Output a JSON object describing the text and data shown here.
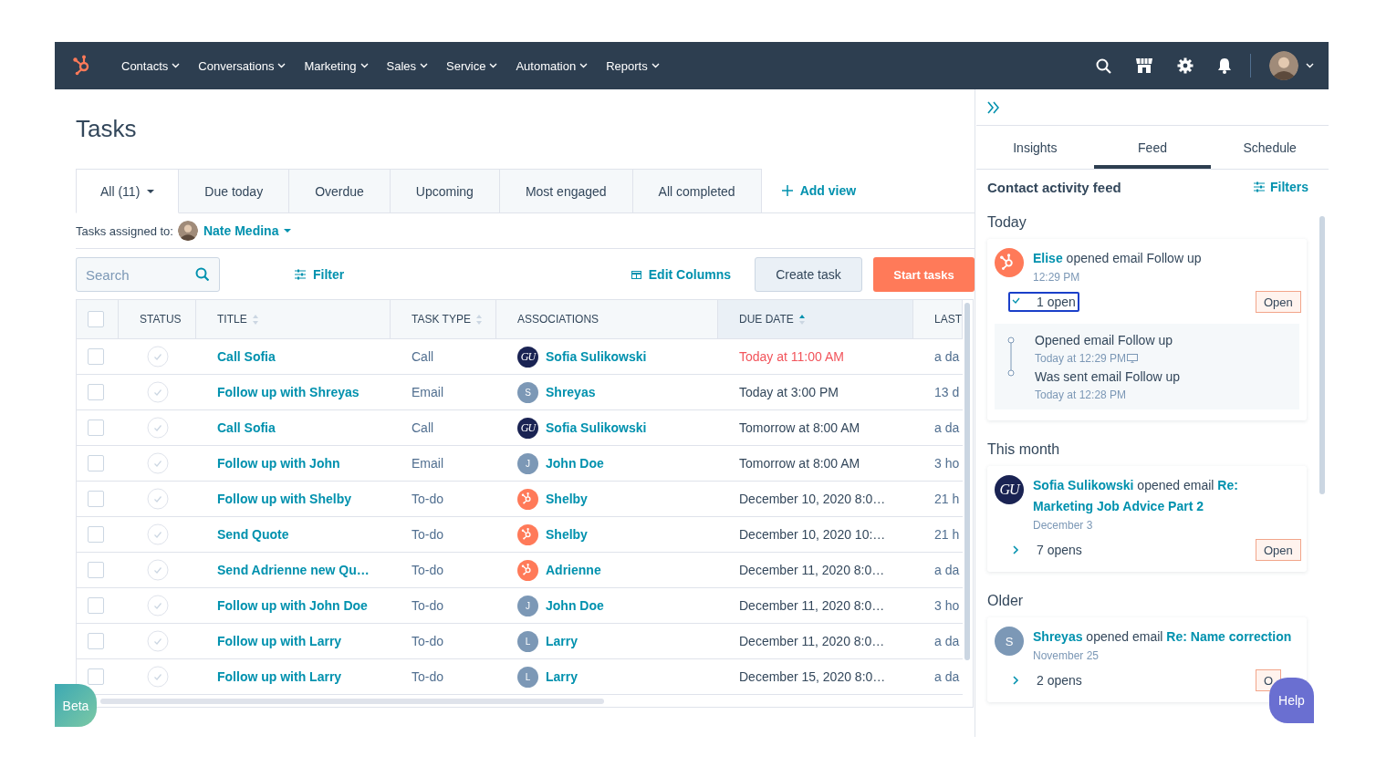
{
  "nav": {
    "items": [
      {
        "label": "Contacts"
      },
      {
        "label": "Conversations"
      },
      {
        "label": "Marketing"
      },
      {
        "label": "Sales"
      },
      {
        "label": "Service"
      },
      {
        "label": "Automation"
      },
      {
        "label": "Reports"
      }
    ]
  },
  "page": {
    "title": "Tasks",
    "views": [
      {
        "label": "All (11)",
        "selected": true,
        "menu": true
      },
      {
        "label": "Due today",
        "selected": false
      },
      {
        "label": "Overdue",
        "selected": false
      },
      {
        "label": "Upcoming",
        "selected": false
      },
      {
        "label": "Most engaged",
        "selected": false
      },
      {
        "label": "All completed",
        "selected": false
      }
    ],
    "add_view": "Add view",
    "assigned_label": "Tasks assigned to:",
    "assignee": "Nate Medina",
    "search": {
      "placeholder": "Search"
    },
    "filter": "Filter",
    "edit_columns": "Edit Columns",
    "create_task": "Create task",
    "start_tasks": "Start tasks",
    "table": {
      "header_checked": false,
      "columns": [
        {
          "label": "STATUS",
          "sortable": false
        },
        {
          "label": "TITLE",
          "sortable": true,
          "sorted": false
        },
        {
          "label": "TASK TYPE",
          "sortable": true,
          "sorted": false
        },
        {
          "label": "ASSOCIATIONS",
          "sortable": false
        },
        {
          "label": "DUE DATE",
          "sortable": true,
          "sorted": true
        },
        {
          "label": "LAST",
          "sortable": false
        }
      ],
      "rows": [
        {
          "checked": false,
          "completed": false,
          "title": "Call Sofia",
          "task_type": "Call",
          "association": {
            "name": "Sofia Sulikowski",
            "avatar": {
              "kind": "monogram",
              "text": "GU"
            }
          },
          "due_date": "Today at 11:00 AM",
          "overdue": true,
          "last": "a da"
        },
        {
          "checked": false,
          "completed": false,
          "title": "Follow up with Shreyas",
          "task_type": "Email",
          "association": {
            "name": "Shreyas",
            "avatar": {
              "kind": "initial",
              "text": "S"
            }
          },
          "due_date": "Today at 3:00 PM",
          "overdue": false,
          "last": "13 d"
        },
        {
          "checked": false,
          "completed": false,
          "title": "Call Sofia",
          "task_type": "Call",
          "association": {
            "name": "Sofia Sulikowski",
            "avatar": {
              "kind": "monogram",
              "text": "GU"
            }
          },
          "due_date": "Tomorrow at 8:00 AM",
          "overdue": false,
          "last": "a da"
        },
        {
          "checked": false,
          "completed": false,
          "title": "Follow up with John",
          "task_type": "Email",
          "association": {
            "name": "John Doe",
            "avatar": {
              "kind": "initial",
              "text": "J"
            }
          },
          "due_date": "Tomorrow at 8:00 AM",
          "overdue": false,
          "last": "3 ho"
        },
        {
          "checked": false,
          "completed": false,
          "title": "Follow up with Shelby",
          "task_type": "To-do",
          "association": {
            "name": "Shelby",
            "avatar": {
              "kind": "logo"
            }
          },
          "due_date": "December 10, 2020 8:0…",
          "overdue": false,
          "last": "21 h"
        },
        {
          "checked": false,
          "completed": false,
          "title": "Send Quote",
          "task_type": "To-do",
          "association": {
            "name": "Shelby",
            "avatar": {
              "kind": "logo"
            }
          },
          "due_date": "December 10, 2020 10:…",
          "overdue": false,
          "last": "21 h"
        },
        {
          "checked": false,
          "completed": false,
          "title": "Send Adrienne new Qu…",
          "task_type": "To-do",
          "association": {
            "name": "Adrienne",
            "avatar": {
              "kind": "logo"
            }
          },
          "due_date": "December 11, 2020 8:0…",
          "overdue": false,
          "last": "a da"
        },
        {
          "checked": false,
          "completed": false,
          "title": "Follow up with John Doe",
          "task_type": "To-do",
          "association": {
            "name": "John Doe",
            "avatar": {
              "kind": "initial",
              "text": "J"
            }
          },
          "due_date": "December 11, 2020 8:0…",
          "overdue": false,
          "last": "3 ho"
        },
        {
          "checked": false,
          "completed": false,
          "title": "Follow up with Larry",
          "task_type": "To-do",
          "association": {
            "name": "Larry",
            "avatar": {
              "kind": "initial",
              "text": "L"
            }
          },
          "due_date": "December 11, 2020 8:0…",
          "overdue": false,
          "last": "a da"
        },
        {
          "checked": false,
          "completed": false,
          "title": "Follow up with Larry",
          "task_type": "To-do",
          "association": {
            "name": "Larry",
            "avatar": {
              "kind": "initial",
              "text": "L"
            }
          },
          "due_date": "December 15, 2020 8:0…",
          "overdue": false,
          "last": "a da"
        }
      ]
    }
  },
  "sidebar": {
    "tabs": [
      {
        "label": "Insights",
        "selected": false
      },
      {
        "label": "Feed",
        "selected": true
      },
      {
        "label": "Schedule",
        "selected": false
      }
    ],
    "feed_title": "Contact activity feed",
    "filters": "Filters",
    "sections": [
      {
        "heading": "Today",
        "cards": [
          {
            "avatar": {
              "kind": "logo"
            },
            "text": "**Elise** opened email Follow up",
            "time": "12:29 PM",
            "opens": "1 open",
            "expanded": true,
            "focused": true,
            "button": "Open",
            "events": [
              {
                "title": "Opened email Follow up",
                "time": "Today at 12:29 PM",
                "desktop": true
              },
              {
                "title": "Was sent email Follow up",
                "time": "Today at 12:28 PM"
              }
            ]
          }
        ]
      },
      {
        "heading": "This month",
        "cards": [
          {
            "avatar": {
              "kind": "monogram",
              "text": "GU"
            },
            "text": "**Sofia Sulikowski** opened email **Re: Marketing Job Advice Part 2**",
            "time": "December 3",
            "opens": "7 opens",
            "expanded": false,
            "focused": false,
            "button": "Open"
          }
        ]
      },
      {
        "heading": "Older",
        "cards": [
          {
            "avatar": {
              "kind": "initial",
              "text": "S"
            },
            "text": "**Shreyas** opened email **Re: Name correction**",
            "time": "November 25",
            "opens": "2 opens",
            "expanded": false,
            "focused": false,
            "button": "O"
          }
        ]
      }
    ]
  },
  "beta": "Beta",
  "help": "Help"
}
